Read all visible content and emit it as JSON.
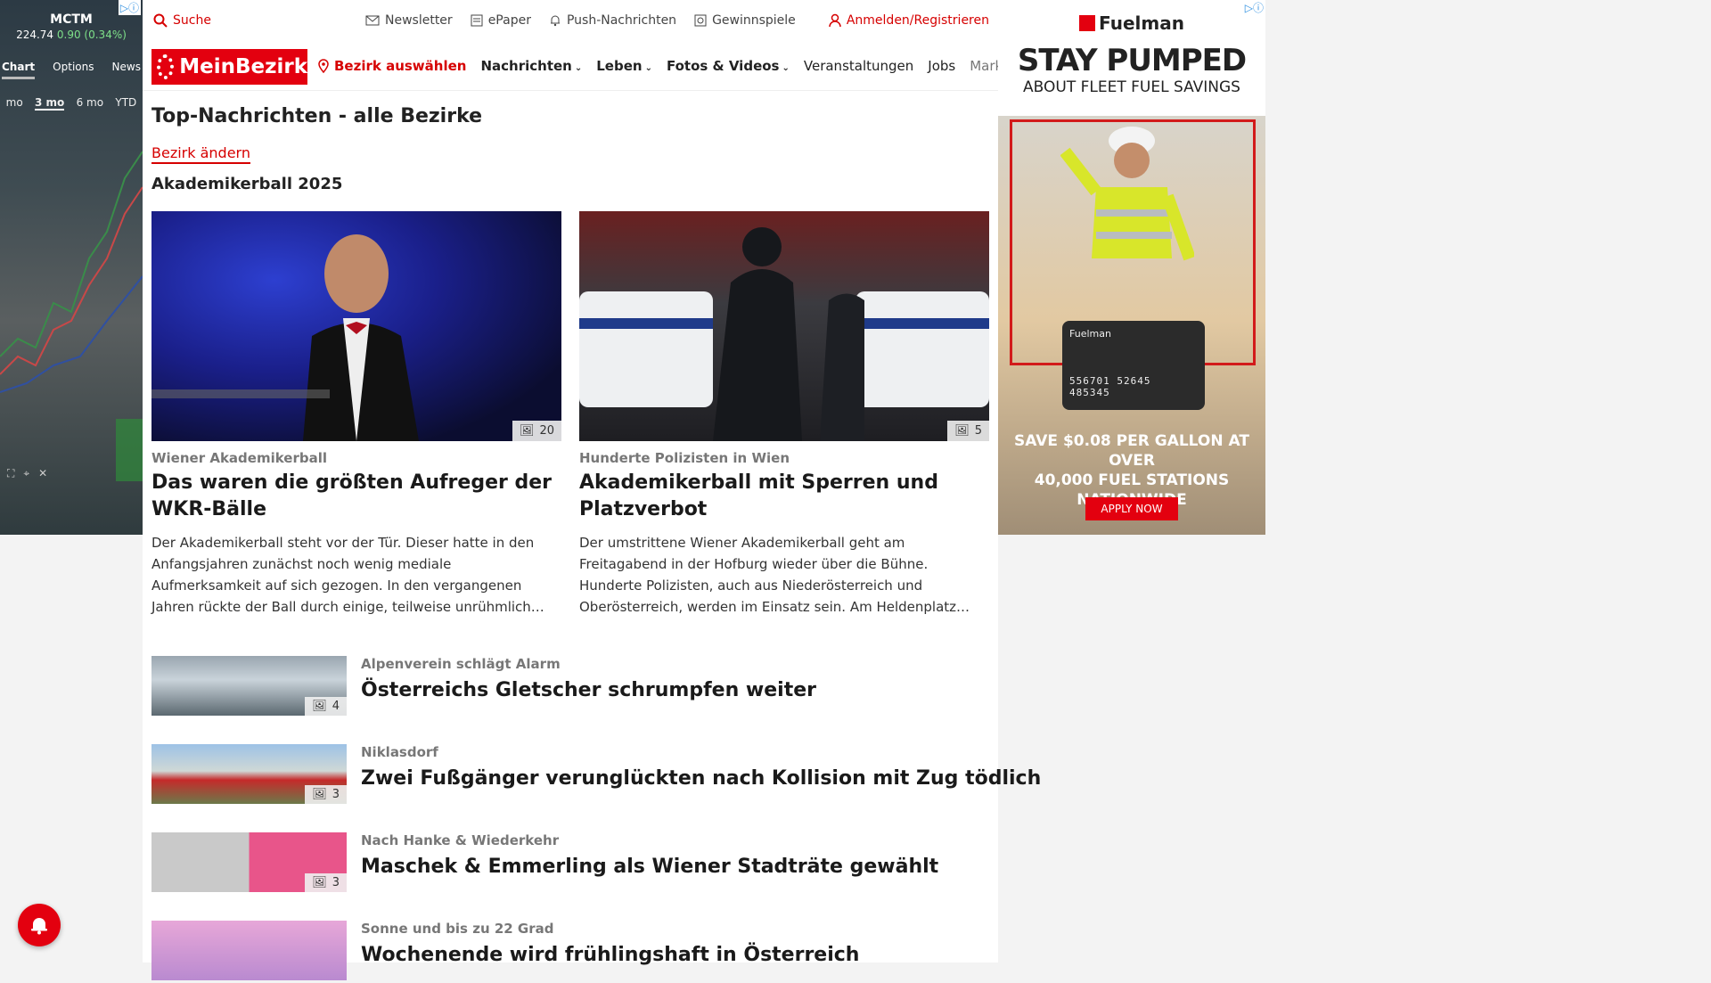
{
  "left_ad": {
    "symbol": "MCTM",
    "price": "224.74",
    "change": "0.90 (0.34%)",
    "tabs": [
      "Chart",
      "Options",
      "News"
    ],
    "ranges": [
      "mo",
      "3 mo",
      "6 mo",
      "YTD"
    ],
    "badge": "▷ⓘ"
  },
  "topbar": {
    "search": "Suche",
    "newsletter": "Newsletter",
    "epaper": "ePaper",
    "push": "Push-Nachrichten",
    "gewinnspiele": "Gewinnspiele",
    "login": "Anmelden/Registrieren"
  },
  "nav": {
    "logo": "MeinBezirk",
    "bezirk": "Bezirk auswählen",
    "nachrichten": "Nachrichten",
    "leben": "Leben",
    "fotos": "Fotos & Videos",
    "veranstaltungen": "Veranstaltungen",
    "jobs": "Jobs",
    "marktplatz": "Marktplatz"
  },
  "section": {
    "title": "Top-Nachrichten - alle Bezirke",
    "change": "Bezirk ändern",
    "topic": "Akademikerball 2025"
  },
  "cards": [
    {
      "kicker": "Wiener Akademikerball",
      "headline": "Das waren die größten Aufreger der WKR-Bälle",
      "teaser": "Der Akademikerball steht vor der Tür. Dieser hatte in den Anfangsjahren zunächst noch wenig mediale Aufmerksamkeit auf sich gezogen. In den vergangenen Jahren rückte der Ball durch einige, teilweise unrühmlich…",
      "count": "20"
    },
    {
      "kicker": "Hunderte Polizisten in Wien",
      "headline": "Akademikerball mit Sperren und Platzverbot",
      "teaser": "Der umstrittene Wiener Akademikerball geht am Freitagabend in der Hofburg wieder über die Bühne. Hunderte Polizisten, auch aus Niederösterreich und Oberösterreich, werden im Einsatz sein. Am Heldenplatz…",
      "count": "5"
    }
  ],
  "rows": [
    {
      "kicker": "Alpenverein schlägt Alarm",
      "headline": "Österreichs Gletscher schrumpfen weiter",
      "count": "4"
    },
    {
      "kicker": "Niklasdorf",
      "headline": "Zwei Fußgänger verunglückten nach Kollision mit Zug tödlich",
      "count": "3"
    },
    {
      "kicker": "Nach Hanke & Wiederkehr",
      "headline": "Maschek & Emmerling als Wiener Stadträte gewählt",
      "count": "3"
    },
    {
      "kicker": "Sonne und bis zu 22 Grad",
      "headline": "Wochenende wird frühlingshaft in Österreich",
      "count": ""
    }
  ],
  "right_ad": {
    "brand": "Fuelman",
    "headline": "STAY PUMPED",
    "subline": "ABOUT FLEET FUEL SAVINGS",
    "card_brand": "Fuelman",
    "card_number": "556701 52645 485345",
    "save_line1": "SAVE $0.08 PER GALLON AT OVER",
    "save_line2": "40,000 FUEL STATIONS NATIONWIDE",
    "cta": "APPLY NOW",
    "badge": "▷ⓘ"
  }
}
